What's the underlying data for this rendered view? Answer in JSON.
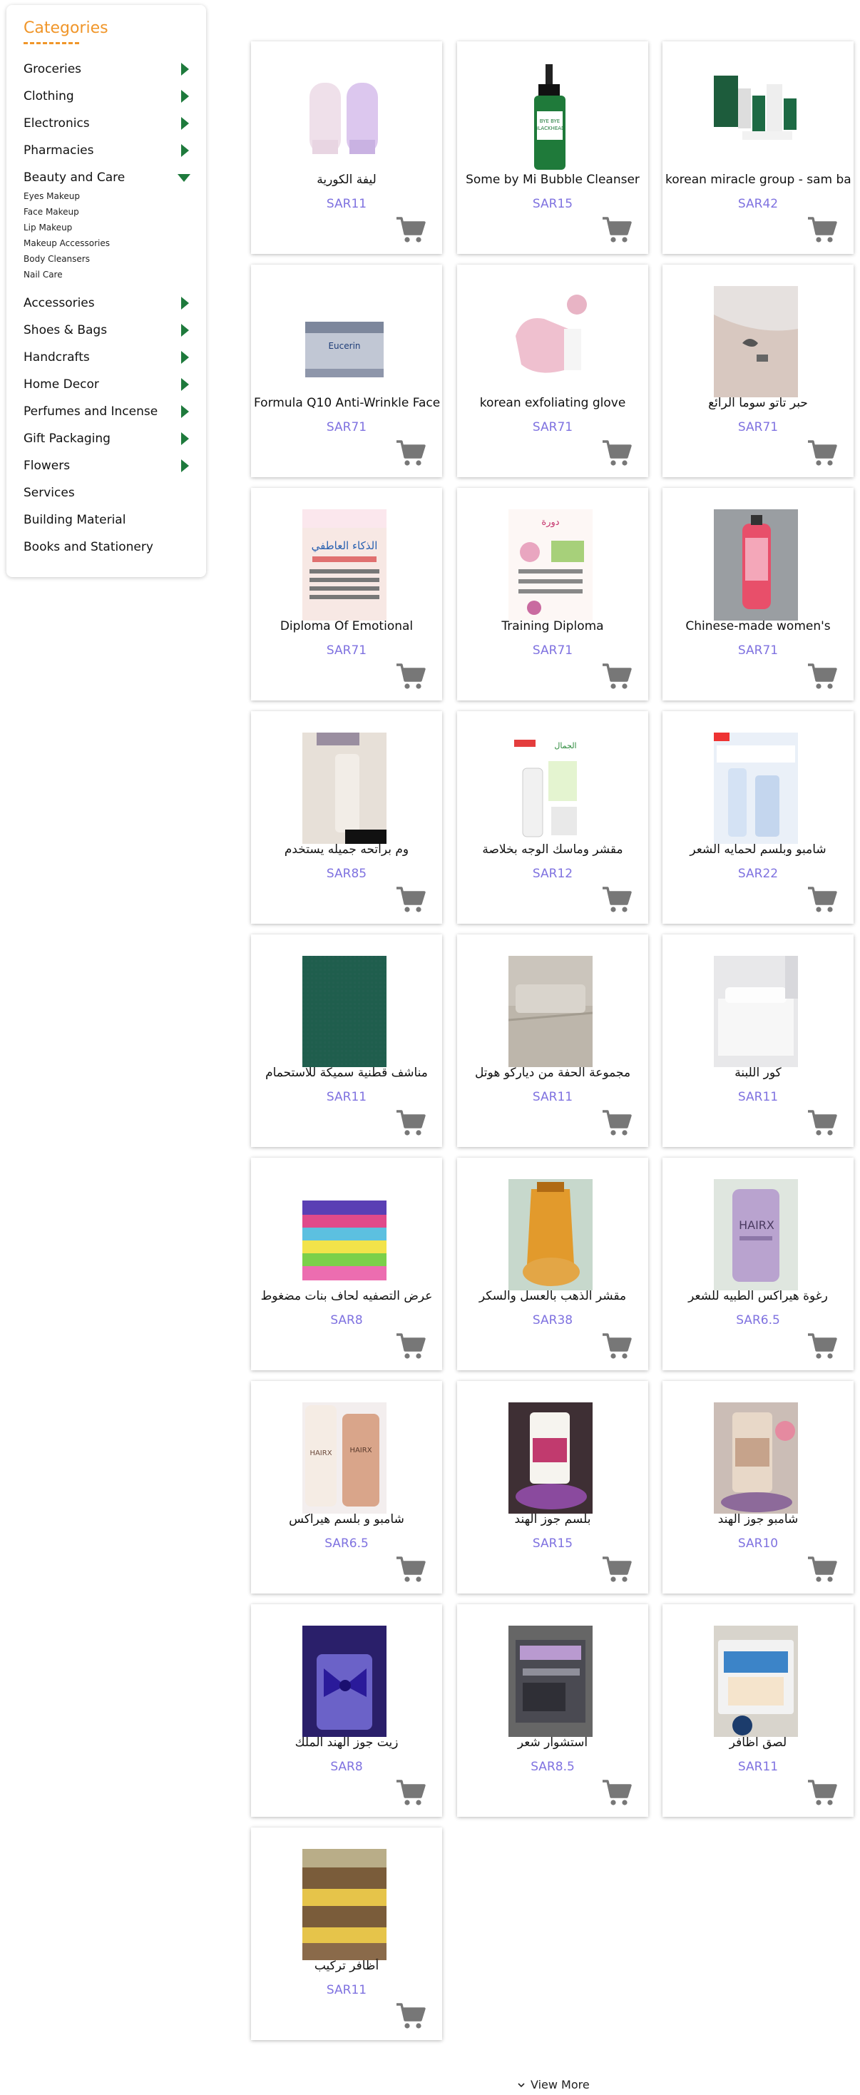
{
  "sidebar": {
    "title": "Categories",
    "categories": [
      {
        "label": "Groceries"
      },
      {
        "label": "Clothing"
      },
      {
        "label": "Electronics"
      },
      {
        "label": "Pharmacies"
      },
      {
        "label": "Beauty and Care",
        "expanded": true,
        "subcategories": [
          "Eyes Makeup",
          "Face Makeup",
          "Lip Makeup",
          "Makeup Accessories",
          "Body Cleansers",
          "Nail Care"
        ]
      },
      {
        "label": "Accessories"
      },
      {
        "label": "Shoes & Bags"
      },
      {
        "label": "Handcrafts"
      },
      {
        "label": "Home Decor"
      },
      {
        "label": "Perfumes and Incense"
      },
      {
        "label": "Gift Packaging"
      },
      {
        "label": "Flowers"
      },
      {
        "label": "Services"
      },
      {
        "label": "Building Material"
      },
      {
        "label": "Books and Stationery"
      }
    ]
  },
  "products": [
    {
      "name": "ليفة الكورية",
      "price": "SAR11"
    },
    {
      "name": "Some by Mi Bubble Cleanser",
      "price": "SAR15"
    },
    {
      "name": "korean miracle group - sam ba",
      "price": "SAR42"
    },
    {
      "name": "Formula Q10 Anti-Wrinkle Face",
      "price": "SAR71"
    },
    {
      "name": "korean exfoliating glove",
      "price": "SAR71"
    },
    {
      "name": "حبر تاتو سوما الرائع",
      "price": "SAR71"
    },
    {
      "name": "Diploma Of Emotional",
      "price": "SAR71"
    },
    {
      "name": "Training Diploma",
      "price": "SAR71"
    },
    {
      "name": "Chinese-made women's",
      "price": "SAR71"
    },
    {
      "name": "وم براتحه جميله يستخدم",
      "price": "SAR85"
    },
    {
      "name": "مقشر وماسك الوجه بخلاصة",
      "price": "SAR12"
    },
    {
      "name": "شامبو وبلسم لحمايه الشعر",
      "price": "SAR22"
    },
    {
      "name": "مناشف قطنية سميكة للاستحمام",
      "price": "SAR11"
    },
    {
      "name": "مجموعة الحفة من دياركو هوتل",
      "price": "SAR11"
    },
    {
      "name": "كور اللبنة",
      "price": "SAR11"
    },
    {
      "name": "عرض التصفيه لحاف بنات مضغوط",
      "price": "SAR8"
    },
    {
      "name": "مقشر الذهب بالعسل والسكر",
      "price": "SAR38"
    },
    {
      "name": "رغوة هيراكس الطبيه للشعر",
      "price": "SAR6.5"
    },
    {
      "name": "شامبو و بلسم هيراكس",
      "price": "SAR6.5"
    },
    {
      "name": "بلسم جوز الهند",
      "price": "SAR15"
    },
    {
      "name": "شامبو جوز الهند",
      "price": "SAR10"
    },
    {
      "name": "زيت جوز الهند الملك",
      "price": "SAR8"
    },
    {
      "name": "استشوار شعر",
      "price": "SAR8.5"
    },
    {
      "name": "لصق اظافر",
      "price": "SAR11"
    },
    {
      "name": "أظافر تركيب",
      "price": "SAR11"
    }
  ],
  "icons": {
    "cart": "shopping-cart-icon",
    "expand": "triangle-right-icon",
    "collapse": "triangle-down-icon",
    "view_more": "chevron-down-icon"
  },
  "colors": {
    "accent": "#f0962a",
    "arrow": "#1e7a3c",
    "price": "#7f72e0",
    "cart": "#777777"
  },
  "view_more": "View More"
}
